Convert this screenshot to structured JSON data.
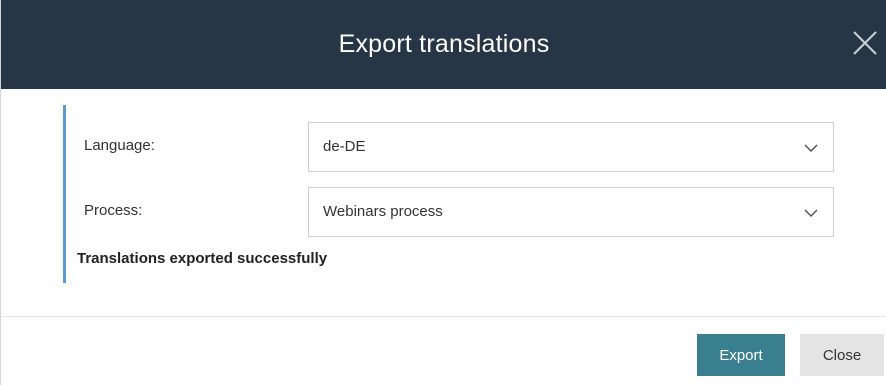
{
  "dialog": {
    "title": "Export translations",
    "close_icon": "close-x-icon",
    "header_color": "#263646"
  },
  "form": {
    "accent_color": "#5b9bd5",
    "language": {
      "label": "Language:",
      "value": "de-DE",
      "icon": "chevron-down-icon"
    },
    "process": {
      "label": "Process:",
      "value": "Webinars process",
      "icon": "chevron-down-icon"
    },
    "status_message": "Translations exported successfully"
  },
  "footer": {
    "export_label": "Export",
    "export_color": "#3a7f8f",
    "close_label": "Close",
    "close_color": "#e4e4e4"
  }
}
